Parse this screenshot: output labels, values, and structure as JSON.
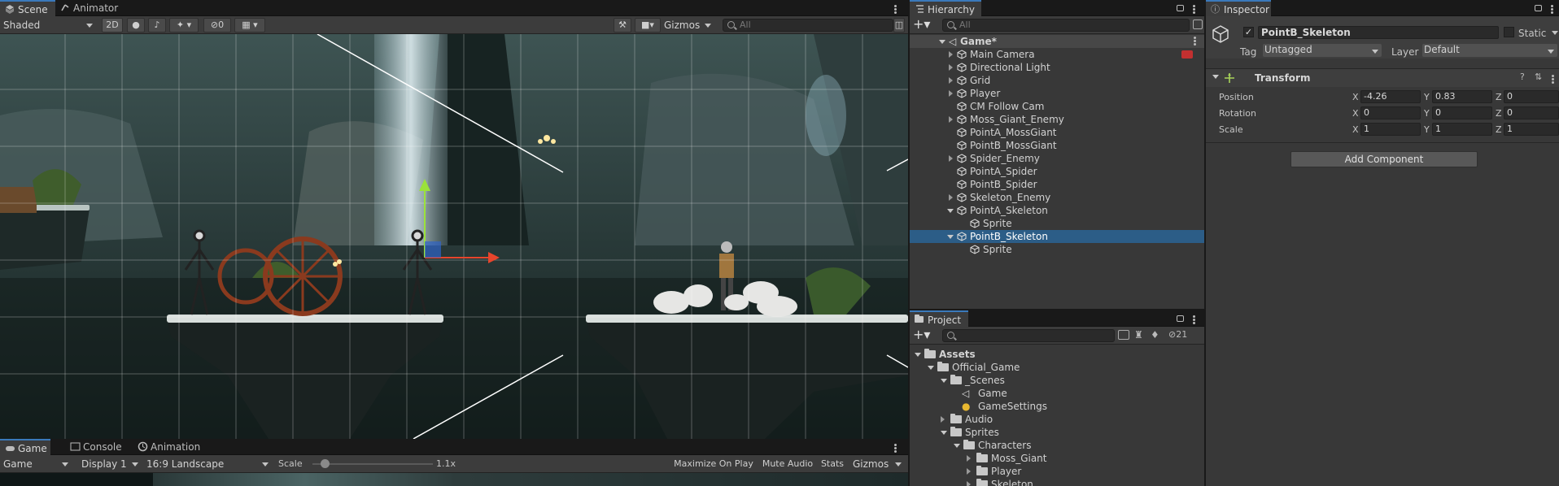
{
  "scene_panel": {
    "tabs": [
      {
        "label": "Scene",
        "icon": "scene-icon"
      },
      {
        "label": "Animator",
        "icon": "animator-icon"
      }
    ],
    "toolbar": {
      "shading_mode": "Shaded",
      "btn_2d": "2D",
      "hidden_count": "0",
      "gizmos": "Gizmos",
      "search_placeholder": "All"
    }
  },
  "game_panel": {
    "tabs": [
      {
        "label": "Game",
        "icon": "game-icon"
      },
      {
        "label": "Console",
        "icon": "console-icon"
      },
      {
        "label": "Animation",
        "icon": "animation-icon"
      }
    ],
    "toolbar": {
      "mode": "Game",
      "display": "Display 1",
      "aspect": "16:9 Landscape",
      "scale_label": "Scale",
      "scale_value": "1.1x",
      "scale_fraction": 0.1,
      "maximize": "Maximize On Play",
      "mute": "Mute Audio",
      "stats": "Stats",
      "gizmos": "Gizmos"
    }
  },
  "hierarchy": {
    "title": "Hierarchy",
    "search_placeholder": "All",
    "scene_name": "Game*",
    "items": [
      {
        "label": "Main Camera",
        "expand": true
      },
      {
        "label": "Directional Light",
        "expand": true
      },
      {
        "label": "Grid",
        "expand": true
      },
      {
        "label": "Player",
        "expand": true
      },
      {
        "label": "CM Follow Cam",
        "expand": false
      },
      {
        "label": "Moss_Giant_Enemy",
        "expand": true
      },
      {
        "label": "PointA_MossGiant",
        "expand": false
      },
      {
        "label": "PointB_MossGiant",
        "expand": false
      },
      {
        "label": "Spider_Enemy",
        "expand": true
      },
      {
        "label": "PointA_Spider",
        "expand": false
      },
      {
        "label": "PointB_Spider",
        "expand": false
      },
      {
        "label": "Skeleton_Enemy",
        "expand": true
      },
      {
        "label": "PointA_Skeleton",
        "expand": "open"
      },
      {
        "label": "Sprite",
        "child": true
      },
      {
        "label": "PointB_Skeleton",
        "expand": "open",
        "selected": true
      },
      {
        "label": "Sprite",
        "child": true
      }
    ]
  },
  "project": {
    "title": "Project",
    "hidden_count": "21",
    "tree": [
      {
        "label": "Assets",
        "depth": 0,
        "open": true
      },
      {
        "label": "Official_Game",
        "depth": 1,
        "open": true
      },
      {
        "label": "_Scenes",
        "depth": 2,
        "open": true
      },
      {
        "label": "Game",
        "depth": 3,
        "kind": "scene"
      },
      {
        "label": "GameSettings",
        "depth": 3,
        "kind": "settings"
      },
      {
        "label": "Audio",
        "depth": 2,
        "open": false
      },
      {
        "label": "Sprites",
        "depth": 2,
        "open": true
      },
      {
        "label": "Characters",
        "depth": 3,
        "open": true
      },
      {
        "label": "Moss_Giant",
        "depth": 4,
        "open": false
      },
      {
        "label": "Player",
        "depth": 4,
        "open": false
      },
      {
        "label": "Skeleton",
        "depth": 4,
        "open": false
      }
    ]
  },
  "inspector": {
    "title": "Inspector",
    "object_name": "PointB_Skeleton",
    "static_label": "Static",
    "tag_label": "Tag",
    "tag_value": "Untagged",
    "layer_label": "Layer",
    "layer_value": "Default",
    "transform_title": "Transform",
    "position": {
      "label": "Position",
      "x": "-4.26",
      "y": "0.83",
      "z": "0"
    },
    "rotation": {
      "label": "Rotation",
      "x": "0",
      "y": "0",
      "z": "0"
    },
    "scale": {
      "label": "Scale",
      "x": "1",
      "y": "1",
      "z": "1"
    },
    "add_component": "Add Component"
  },
  "colors": {
    "accent": "#3a79bb",
    "selection": "#2c5d87",
    "panel": "#383838",
    "toolbar": "#3c3c3c"
  }
}
